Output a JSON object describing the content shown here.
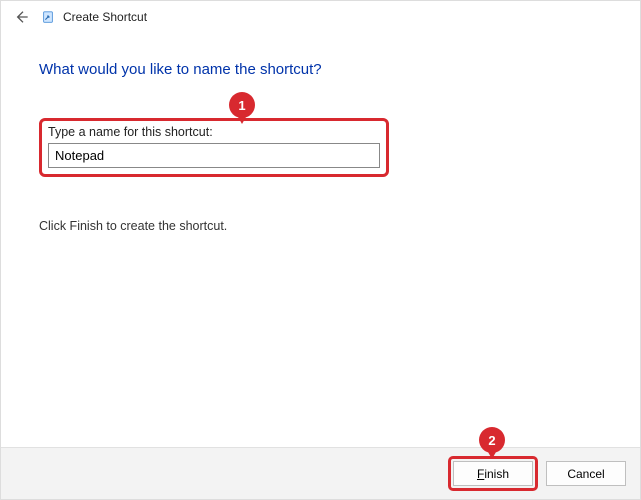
{
  "window": {
    "title": "Create Shortcut"
  },
  "heading": "What would you like to name the shortcut?",
  "field": {
    "label": "Type a name for this shortcut:",
    "value": "Notepad"
  },
  "instruction": "Click Finish to create the shortcut.",
  "buttons": {
    "finish_prefix": "F",
    "finish_rest": "inish",
    "cancel": "Cancel"
  },
  "annotations": {
    "step1": "1",
    "step2": "2"
  }
}
